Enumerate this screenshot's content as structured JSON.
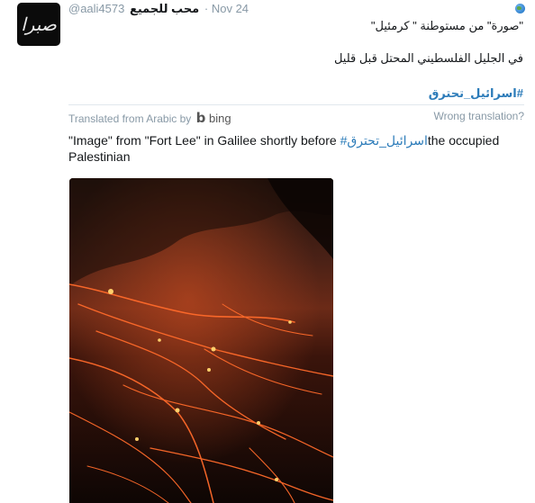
{
  "tweet": {
    "handle": "@aali4573",
    "display_name": "محب للجميع",
    "separator": "·",
    "date": "Nov 24",
    "avatar_text": "صبرا",
    "original_line1": "\"صورة\" من مستوطنة \" كرمئيل\"",
    "original_line2": "في الجليل الفلسطيني المحتل قبل قليل",
    "hashtag": "#اسرائيل_تحترق",
    "translation_header": {
      "translated_from": "Translated from Arabic by",
      "provider": "bing",
      "wrong_translation": "Wrong translation?"
    },
    "translation_part1": "\"Image\" from \"Fort Lee\" in Galilee shortly before ",
    "translation_hashtag": "#اسرائيل_تحترق",
    "translation_part2": "the occupied Palestinian"
  },
  "icons": {
    "globe": "globe-icon",
    "bing": "bing-logo-icon"
  },
  "colors": {
    "link": "#2b7bb9",
    "muted": "#8899a6"
  }
}
